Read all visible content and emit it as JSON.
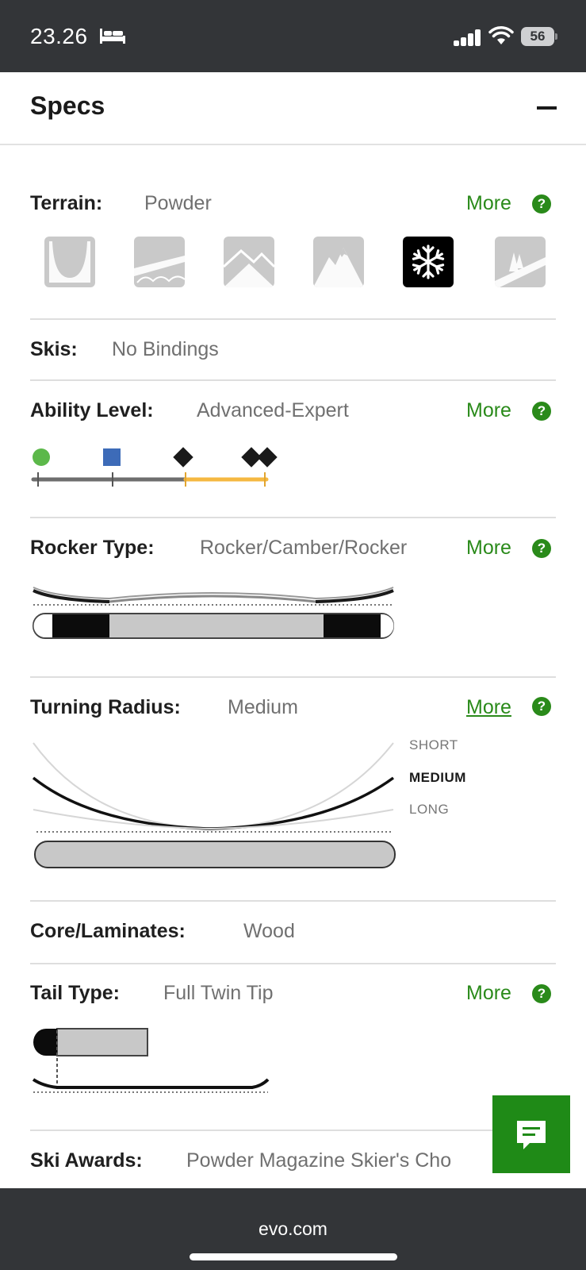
{
  "status_bar": {
    "time": "23.26",
    "battery": "56"
  },
  "header": {
    "title": "Specs"
  },
  "terrain": {
    "label": "Terrain:",
    "value": "Powder",
    "more": "More",
    "icons": [
      "halfpipe-terrain-icon",
      "park-terrain-icon",
      "all-mountain-terrain-icon",
      "big-mountain-terrain-icon",
      "powder-snowflake-icon",
      "backcountry-terrain-icon"
    ],
    "active_index": 4
  },
  "skis": {
    "label": "Skis:",
    "value": "No Bindings"
  },
  "ability": {
    "label": "Ability Level:",
    "value": "Advanced-Expert",
    "more": "More",
    "levels": [
      "beginner-green-circle-icon",
      "intermediate-blue-square-icon",
      "advanced-black-diamond-icon",
      "expert-double-diamond-icon"
    ],
    "highlight_color": "#f5b841"
  },
  "rocker": {
    "label": "Rocker Type:",
    "value": "Rocker/Camber/Rocker",
    "more": "More"
  },
  "turning_radius": {
    "label": "Turning Radius:",
    "value": "Medium",
    "more": "More",
    "scale": [
      "SHORT",
      "MEDIUM",
      "LONG"
    ]
  },
  "core": {
    "label": "Core/Laminates:",
    "value": "Wood"
  },
  "tail": {
    "label": "Tail Type:",
    "value": "Full Twin Tip",
    "more": "More"
  },
  "awards": {
    "label": "Ski Awards:",
    "value": "Powder Magazine Skier's Cho"
  },
  "help_glyph": "?",
  "colors": {
    "accent_green": "#2a8a1a",
    "chat_green": "#1f8a17",
    "bars_dark": "#333538"
  },
  "browser": {
    "url": "evo.com"
  }
}
